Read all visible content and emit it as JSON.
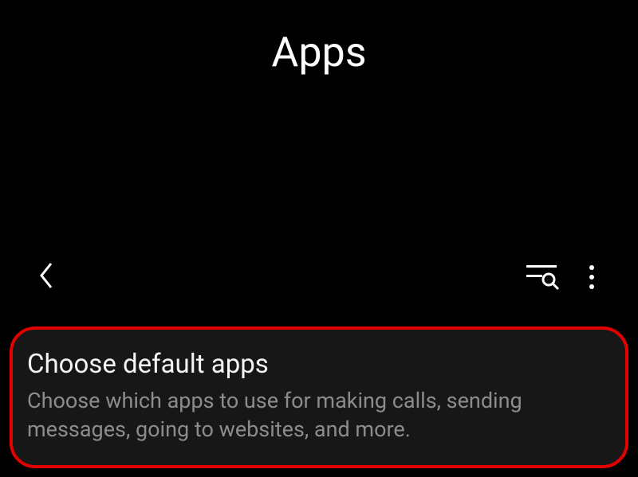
{
  "header": {
    "title": "Apps"
  },
  "card": {
    "title": "Choose default apps",
    "description": "Choose which apps to use for making calls, sending messages, going to websites, and more."
  }
}
